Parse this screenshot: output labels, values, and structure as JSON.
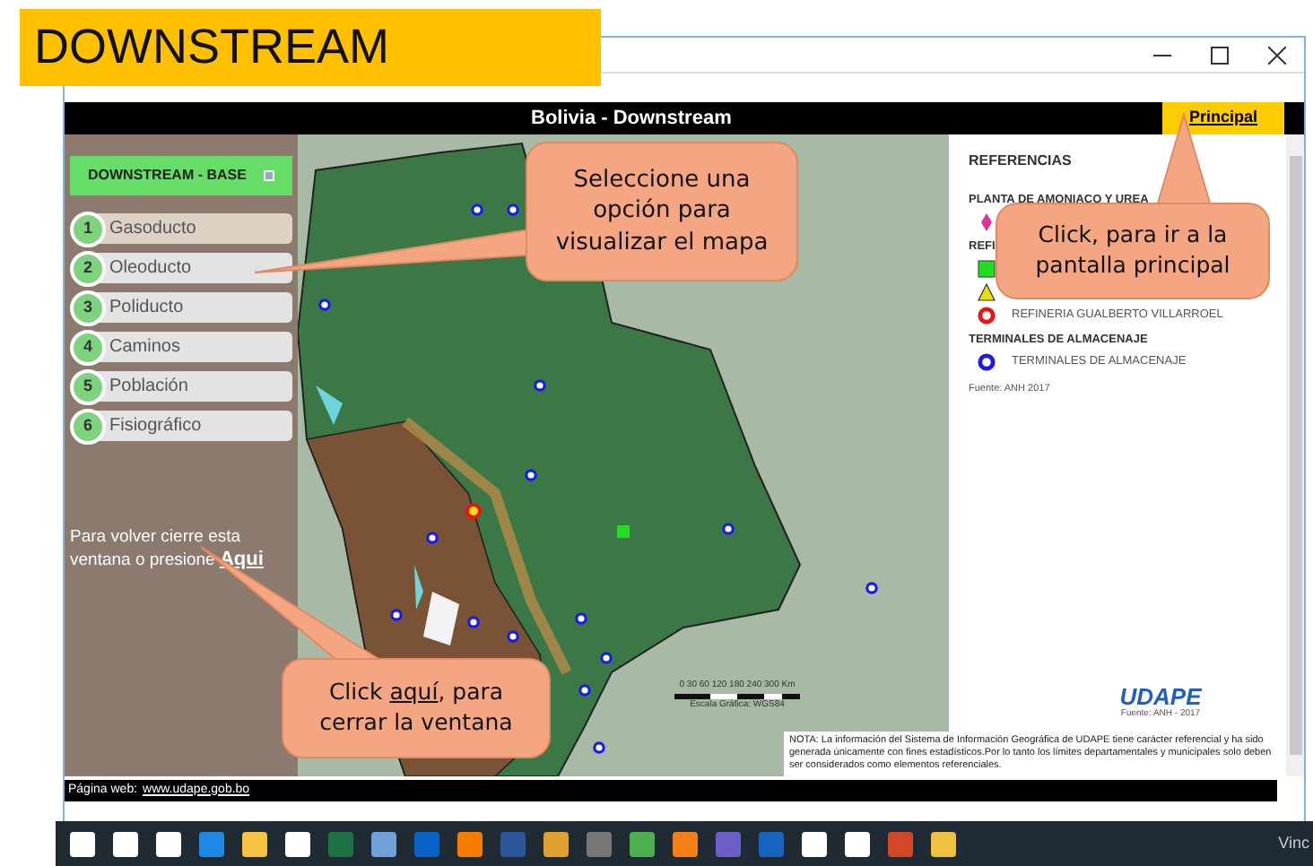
{
  "banner": {
    "title": "DOWNSTREAM"
  },
  "header": {
    "title": "Bolivia - Downstream",
    "link": "Principal"
  },
  "sidebar": {
    "dropdown": "DOWNSTREAM - BASE",
    "items": [
      {
        "number": "1",
        "label": "Gasoducto",
        "selected": true
      },
      {
        "number": "2",
        "label": "Oleoducto",
        "selected": false
      },
      {
        "number": "3",
        "label": "Poliducto",
        "selected": false
      },
      {
        "number": "4",
        "label": "Caminos",
        "selected": false
      },
      {
        "number": "5",
        "label": "Población",
        "selected": false
      },
      {
        "number": "6",
        "label": "Fisiográfico",
        "selected": false
      }
    ],
    "close_text": "Para volver cierre esta ventana o presione",
    "close_link": "Aqui"
  },
  "map": {
    "scale_ticks": "0 30 60 120 180 240 300 Km",
    "scale_label": "Escala Gráfica: WGS84"
  },
  "legend": {
    "title": "REFERENCIAS",
    "sections": [
      {
        "heading": "PLANTA DE AMONIACO Y UREA",
        "items": [
          {
            "kind": "diamond",
            "color": "#e0309a"
          }
        ]
      },
      {
        "heading": "REFI",
        "items": [
          {
            "kind": "square",
            "color": "#22dd22"
          },
          {
            "kind": "triangle",
            "color": "#e8e000"
          },
          {
            "kind": "ring",
            "color": "#ee1111",
            "label": "REFINERIA GUALBERTO VILLARROEL"
          }
        ]
      },
      {
        "heading": "TERMINALES DE ALMACENAJE",
        "items": [
          {
            "kind": "ring",
            "color": "#1a1aee",
            "label": "TERMINALES DE ALMACENAJE"
          }
        ]
      }
    ],
    "source": "Fuente: ANH 2017",
    "logo": "UDAPE",
    "logo_source": "Fuente: ANH - 2017"
  },
  "note": "NOTA: La información del Sistema de Información Geográfica de UDAPE tiene carácter referencial y ha sido generada únicamente con fines estadísticos.Por lo tanto los límites departamentales y municipales solo deben ser considerados como elementos referenciales.",
  "footer": {
    "label": "Página web:",
    "link": "www.udape.gob.bo"
  },
  "callouts": [
    {
      "parts": [
        {
          "text": "Seleccione una opción para visualizar el mapa",
          "underline": false
        }
      ]
    },
    {
      "parts": [
        {
          "text": "Click, para ir a la pantalla principal",
          "underline": false
        }
      ]
    },
    {
      "parts": [
        {
          "text": "Click ",
          "underline": false
        },
        {
          "text": "aquí",
          "underline": true
        },
        {
          "text": ", para cerrar la ventana",
          "underline": false
        }
      ]
    }
  ],
  "taskbar": {
    "tray_text": "Vinc"
  }
}
